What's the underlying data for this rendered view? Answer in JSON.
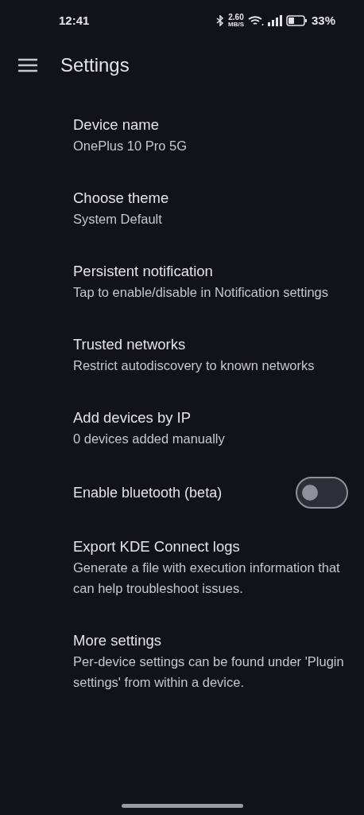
{
  "status_bar": {
    "time": "12:41",
    "speed_value": "2.60",
    "speed_unit": "MB/S",
    "battery": "33%"
  },
  "app_bar": {
    "title": "Settings"
  },
  "settings": [
    {
      "kind": "text",
      "title": "Device name",
      "subtitle": "OnePlus 10 Pro 5G"
    },
    {
      "kind": "text",
      "title": "Choose theme",
      "subtitle": "System Default"
    },
    {
      "kind": "text",
      "title": "Persistent notification",
      "subtitle": "Tap to enable/disable in Notification settings"
    },
    {
      "kind": "text",
      "title": "Trusted networks",
      "subtitle": "Restrict autodiscovery to known networks"
    },
    {
      "kind": "text",
      "title": "Add devices by IP",
      "subtitle": "0 devices added manually"
    },
    {
      "kind": "switch",
      "title": "Enable bluetooth (beta)",
      "on": false
    },
    {
      "kind": "text",
      "title": "Export KDE Connect logs",
      "subtitle": "Generate a file with execution information that can help troubleshoot issues."
    },
    {
      "kind": "text",
      "title": "More settings",
      "subtitle": "Per-device settings can be found under 'Plugin settings' from within a device."
    }
  ]
}
